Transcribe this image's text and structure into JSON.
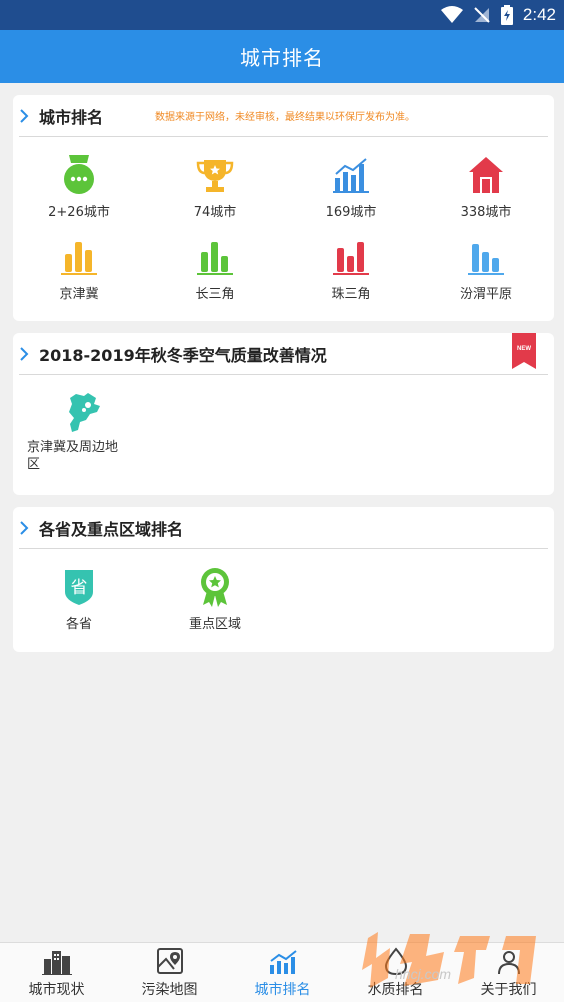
{
  "status": {
    "time": "2:42"
  },
  "app_bar": {
    "title": "城市排名"
  },
  "ranking_card": {
    "title": "城市排名",
    "note": "数据来源于网络，未经审核，最终结果以环保厅发布为准。",
    "items": [
      {
        "label": "2+26城市",
        "icon": "badge-dots-icon",
        "color": "#5cc43a"
      },
      {
        "label": "74城市",
        "icon": "trophy-icon",
        "color": "#f5b52a"
      },
      {
        "label": "169城市",
        "icon": "line-bar-chart-icon",
        "color": "#3b8fe0"
      },
      {
        "label": "338城市",
        "icon": "house-icon",
        "color": "#e23a4a"
      },
      {
        "label": "京津冀",
        "icon": "bar-chart-icon",
        "color": "#f5b52a"
      },
      {
        "label": "长三角",
        "icon": "bar-chart-icon",
        "color": "#5cc43a"
      },
      {
        "label": "珠三角",
        "icon": "bar-chart-icon",
        "color": "#e23a4a"
      },
      {
        "label": "汾渭平原",
        "icon": "bar-chart-icon",
        "color": "#4fa8ec"
      }
    ]
  },
  "autumn_card": {
    "title": "2018-2019年秋冬季空气质量改善情况",
    "badge": "NEW",
    "items": [
      {
        "label": "京津冀及周边地区",
        "icon": "region-map-icon",
        "color": "#35c3b0"
      }
    ]
  },
  "province_card": {
    "title": "各省及重点区域排名",
    "items": [
      {
        "label": "各省",
        "icon_text": "省",
        "icon": "province-shield-icon",
        "color": "#35c3b0"
      },
      {
        "label": "重点区域",
        "icon": "star-medal-icon",
        "color": "#5cc43a"
      }
    ]
  },
  "bottom_nav": {
    "items": [
      {
        "label": "城市现状",
        "icon": "city-buildings-icon",
        "active": false
      },
      {
        "label": "污染地图",
        "icon": "map-pin-icon",
        "active": false
      },
      {
        "label": "城市排名",
        "icon": "trend-chart-icon",
        "active": true
      },
      {
        "label": "水质排名",
        "icon": "water-drop-icon",
        "active": false
      },
      {
        "label": "关于我们",
        "icon": "people-icon",
        "active": false
      }
    ],
    "active_color": "#2b8ee6"
  },
  "watermark": {
    "text": "hncj.com"
  }
}
